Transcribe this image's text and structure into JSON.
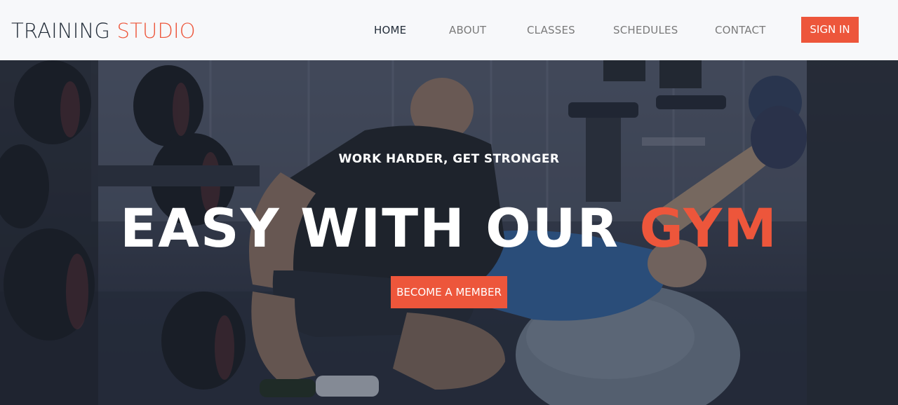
{
  "brand": {
    "part1": "TRAINING ",
    "part2": "STUDIO"
  },
  "nav": {
    "items": [
      {
        "label": "HOME"
      },
      {
        "label": "ABOUT"
      },
      {
        "label": "CLASSES"
      },
      {
        "label": "SCHEDULES"
      },
      {
        "label": "CONTACT"
      }
    ],
    "signin_label": "SIGN IN"
  },
  "hero": {
    "subtitle": "WORK HARDER, GET STRONGER",
    "title_main": "EASY WITH OUR ",
    "title_accent": "GYM",
    "cta_label": "BECOME A MEMBER",
    "background_image": "gym-training-photo"
  },
  "colors": {
    "accent": "#ed563b",
    "header_bg": "#f7f8fa",
    "dark_text": "#232d39",
    "nav_text": "#7a7a7a"
  }
}
